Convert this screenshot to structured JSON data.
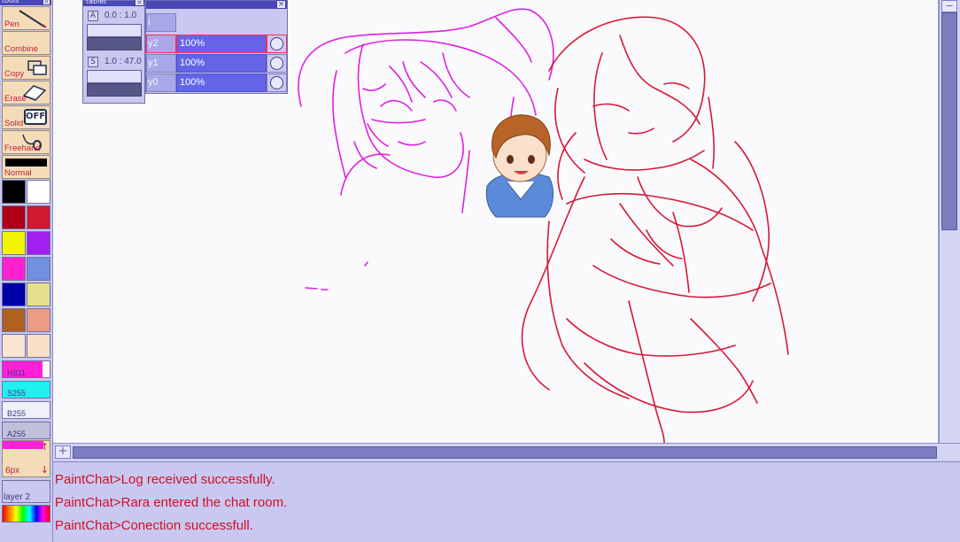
{
  "tools_panel": {
    "title": "tools",
    "close_glyph": "×",
    "tools": [
      {
        "label": "Pen",
        "icon": "pen-icon"
      },
      {
        "label": "Combine",
        "icon": "none"
      },
      {
        "label": "Copy",
        "icon": "copy-icon"
      },
      {
        "label": "Erase",
        "icon": "eraser-icon"
      },
      {
        "label": "Solid",
        "icon": "off-toggle-icon",
        "icon_text": "OFF"
      },
      {
        "label": "Freehand",
        "icon": "freehand-icon",
        "icon_text": "0"
      },
      {
        "label": "Normal",
        "icon": "none"
      }
    ],
    "palette": [
      "#000000",
      "#ffffff",
      "#b00018",
      "#d01830",
      "#f4f400",
      "#a020f0",
      "#ff20d0",
      "#7090e0",
      "#0000a8",
      "#e4e08c",
      "#b06020",
      "#ec9c84",
      "#f8e4d0",
      "#f8e0c4"
    ],
    "hsba": [
      {
        "label": "H311",
        "fraction": 0.85,
        "color": "#ff20d8"
      },
      {
        "label": "S255",
        "fraction": 1.0,
        "color": "#20f0f0"
      },
      {
        "label": "B255",
        "fraction": 1.0,
        "color": "#f0f0f8"
      },
      {
        "label": "A255",
        "fraction": 1.0,
        "color": "#c0c0d8"
      }
    ],
    "pen_size": "6px",
    "size_up": "↑",
    "size_down": "↓",
    "current_layer": "layer 2"
  },
  "tablet_window": {
    "title": "tablet",
    "close_glyph": "×",
    "sections": [
      {
        "key": "A",
        "range": "0.0 : 1.0"
      },
      {
        "key": "S",
        "range": "1.0 : 47.0"
      }
    ]
  },
  "layers_window": {
    "close_glyph": "×",
    "rows": [
      {
        "name": "i",
        "opacity": "",
        "active": false
      },
      {
        "name": "y2",
        "opacity": "100%",
        "active": true
      },
      {
        "name": "y1",
        "opacity": "100%",
        "active": false
      },
      {
        "name": "y0",
        "opacity": "100%",
        "active": false
      }
    ]
  },
  "canvas": {
    "stroke_colors": {
      "magenta": "#e020e0",
      "red": "#d81838"
    }
  },
  "scrollbars": {
    "plus_glyph": "+",
    "minus_glyph": "−",
    "up_glyph": "−"
  },
  "chat_log": {
    "lines": [
      "PaintChat>Log received successfully.",
      "PaintChat>Rara entered the chat room.",
      "PaintChat>Conection successfull."
    ]
  }
}
